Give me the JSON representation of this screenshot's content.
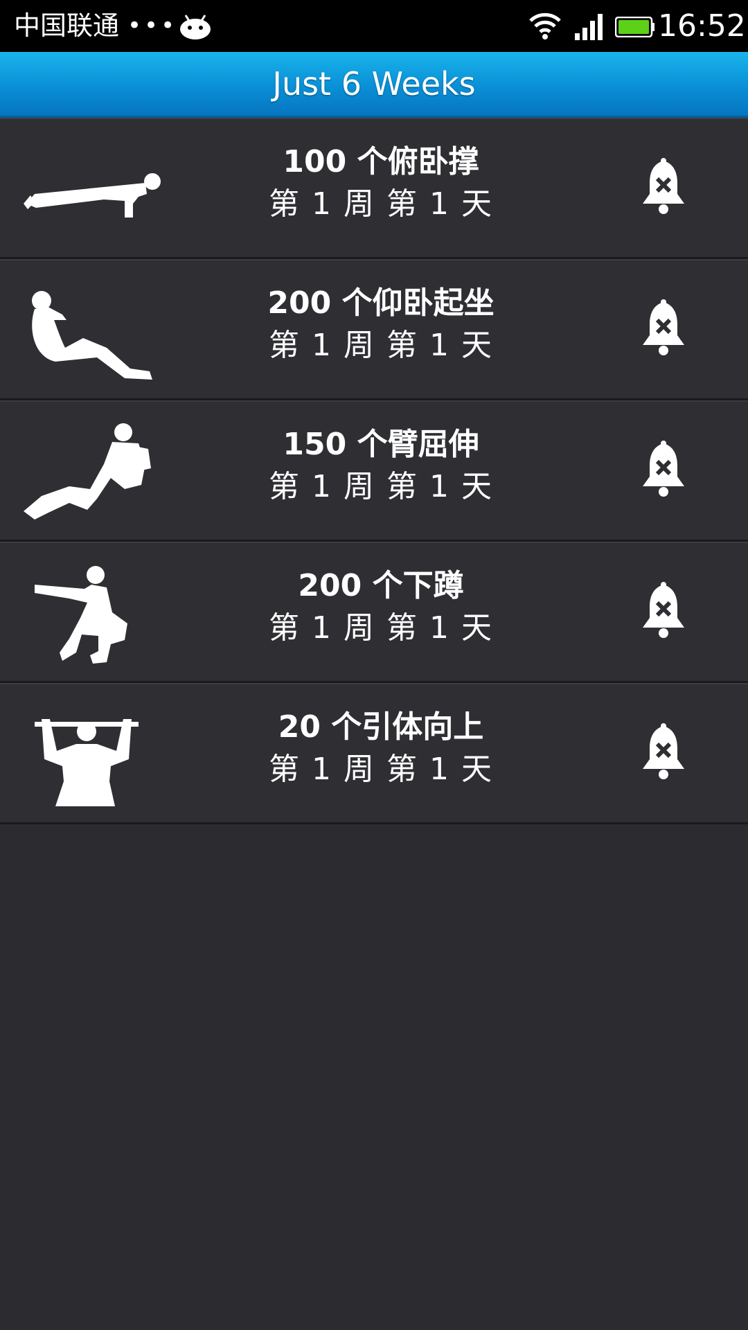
{
  "status_bar": {
    "carrier": "中国联通",
    "dots": "•••",
    "time": "16:52",
    "battery_color": "#5cd118"
  },
  "app_bar": {
    "title": "Just 6 Weeks",
    "color": "#0a8fd6"
  },
  "workouts": [
    {
      "title": "100 个俯卧撑",
      "progress": "第 1 周 第 1 天",
      "icon": "pushup-icon"
    },
    {
      "title": "200 个仰卧起坐",
      "progress": "第 1 周 第 1 天",
      "icon": "situp-icon"
    },
    {
      "title": "150 个臂屈伸",
      "progress": "第 1 周 第 1 天",
      "icon": "dip-icon"
    },
    {
      "title": "200 个下蹲",
      "progress": "第 1 周 第 1 天",
      "icon": "squat-icon"
    },
    {
      "title": "20 个引体向上",
      "progress": "第 1 周 第 1 天",
      "icon": "pullup-icon"
    }
  ]
}
